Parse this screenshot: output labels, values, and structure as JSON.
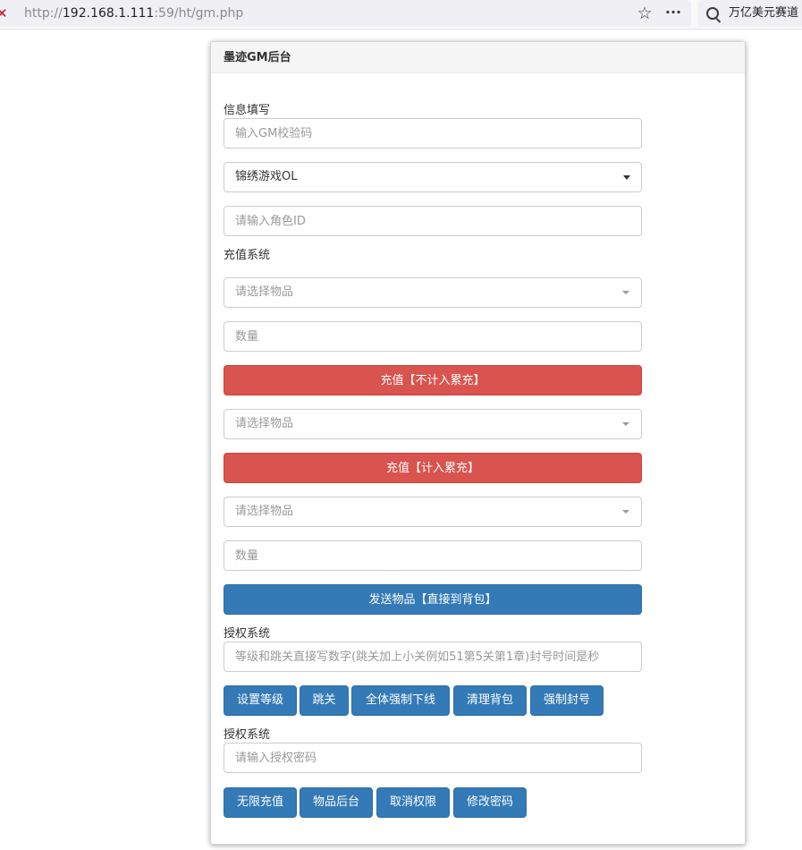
{
  "browser": {
    "url_prefix": "http://",
    "url_host": "192.168.1.111",
    "url_rest": ":59/ht/gm.php",
    "search_text": "万亿美元赛道"
  },
  "panel": {
    "title": "墨迹GM后台"
  },
  "info_section": {
    "label": "信息填写",
    "gm_code_placeholder": "输入GM校验码",
    "game_select_value": "锦绣游戏OL",
    "role_id_placeholder": "请输入角色ID"
  },
  "recharge_section": {
    "label": "充值系统",
    "item_select_1_placeholder": "请选择物品",
    "quantity_1_placeholder": "数量",
    "recharge_no_accum_label": "充值【不计入累充】",
    "item_select_2_placeholder": "请选择物品",
    "recharge_accum_label": "充值【计入累充】",
    "item_select_3_placeholder": "请选择物品",
    "quantity_2_placeholder": "数量",
    "send_item_label": "发送物品【直接到背包】"
  },
  "auth_section_1": {
    "label": "授权系统",
    "input_placeholder": "等级和跳关直接写数字(跳关加上小关例如51第5关第1章)封号时间是秒",
    "buttons": [
      "设置等级",
      "跳关",
      "全体强制下线",
      "清理背包",
      "强制封号"
    ]
  },
  "auth_section_2": {
    "label": "授权系统",
    "password_placeholder": "请输入授权密码",
    "buttons": [
      "无限充值",
      "物品后台",
      "取消权限",
      "修改密码"
    ]
  },
  "colors": {
    "danger": "#d9534f",
    "primary": "#337ab7"
  }
}
